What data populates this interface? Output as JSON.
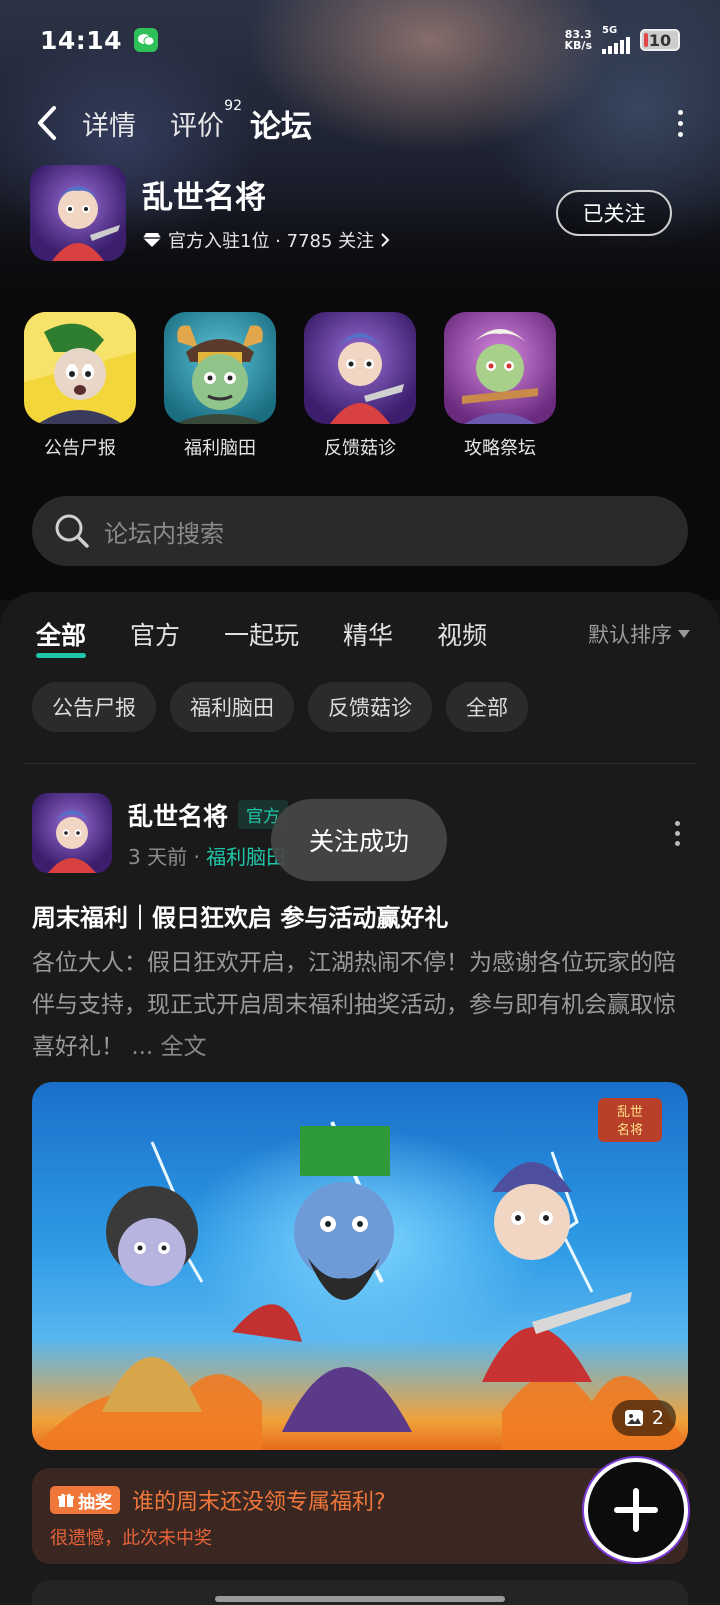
{
  "status_bar": {
    "time": "14:14",
    "net_speed_value": "83.3",
    "net_speed_unit": "KB/s",
    "network": "5G",
    "battery": "10"
  },
  "nav": {
    "tabs": [
      {
        "label": "详情"
      },
      {
        "label": "评价",
        "badge": "92"
      },
      {
        "label": "论坛"
      }
    ],
    "active_tab": "论坛"
  },
  "app": {
    "name": "乱世名将",
    "meta": "官方入驻1位 · 7785 关注",
    "follow_label": "已关注"
  },
  "forums": [
    {
      "label": "公告尸报"
    },
    {
      "label": "福利脑田"
    },
    {
      "label": "反馈菇诊"
    },
    {
      "label": "攻略祭坛"
    }
  ],
  "search": {
    "placeholder": "论坛内搜索"
  },
  "content_tabs": [
    {
      "label": "全部"
    },
    {
      "label": "官方"
    },
    {
      "label": "一起玩"
    },
    {
      "label": "精华"
    },
    {
      "label": "视频"
    }
  ],
  "sort_label": "默认排序",
  "chips": [
    {
      "label": "公告尸报"
    },
    {
      "label": "福利脑田"
    },
    {
      "label": "反馈菇诊"
    },
    {
      "label": "全部"
    }
  ],
  "post": {
    "author": "乱世名将",
    "tag": "官方",
    "time": "3 天前",
    "board": "福利脑田",
    "title": "周末福利｜假日狂欢启 参与活动赢好礼",
    "body": "各位大人：假日狂欢开启，江湖热闹不停！为感谢各位玩家的陪伴与支持，现正式开启周末福利抽奖活动，参与即有机会赢取惊喜好礼！",
    "more_label": "... 全文",
    "image_count": "2",
    "image_logo": "乱世名将"
  },
  "lottery": {
    "tag": "抽奖",
    "title": "谁的周末还没领专属福利?",
    "result": "很遗憾，此次未中奖"
  },
  "toast": "关注成功",
  "colors": {
    "accent": "#1fc5a8",
    "lottery": "#f0773a",
    "background": "#121212"
  }
}
